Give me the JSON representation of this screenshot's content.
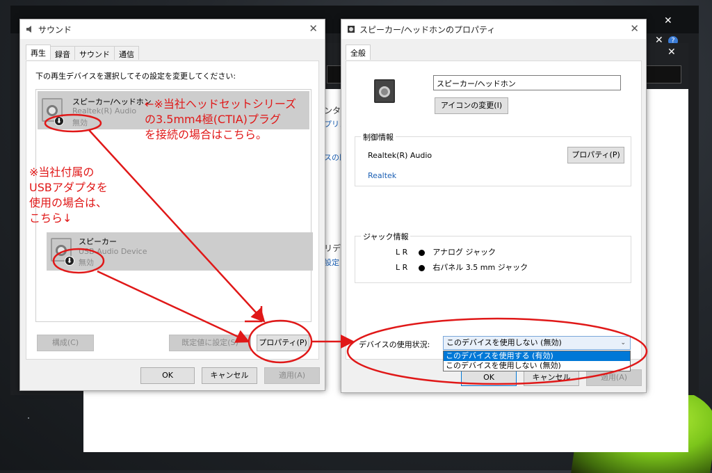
{
  "sound_window": {
    "title": "サウンド",
    "tabs": [
      "再生",
      "録音",
      "サウンド",
      "通信"
    ],
    "active_tab": 0,
    "instruction": "下の再生デバイスを選択してその設定を変更してください:",
    "devices": [
      {
        "name": "スピーカー/ヘッドホン",
        "driver": "Realtek(R) Audio",
        "status": "無効"
      },
      {
        "name": "スピーカー",
        "driver": "USB Audio Device",
        "status": "無効"
      }
    ],
    "buttons": {
      "configure": "構成(C)",
      "set_default": "既定値に設定(S)",
      "properties": "プロパティ(P)"
    },
    "footer": {
      "ok": "OK",
      "cancel": "キャンセル",
      "apply": "適用(A)"
    }
  },
  "props_window": {
    "title": "スピーカー/ヘッドホンのプロパティ",
    "tab": "全般",
    "device_name": "スピーカー/ヘッドホン",
    "change_icon": "アイコンの変更(I)",
    "controller_group": "制御情報",
    "controller_name": "Realtek(R) Audio",
    "controller_props": "プロパティ(P)",
    "vendor_link": "Realtek",
    "jack_group": "ジャック情報",
    "jacks": [
      {
        "channels": "L R",
        "desc": "アナログ ジャック"
      },
      {
        "channels": "L R",
        "desc": "右パネル 3.5 mm ジャック"
      }
    ],
    "usage_label": "デバイスの使用状況:",
    "usage_value": "このデバイスを使用しない (無効)",
    "usage_options": [
      "このデバイスを使用する (有効)",
      "このデバイスを使用しない (無効)"
    ],
    "footer": {
      "ok": "OK",
      "cancel": "キャンセル",
      "apply": "適用(A)"
    }
  },
  "annotations": {
    "note1": [
      "←※当社ヘッドセットシリーズ",
      "の3.5mm4極(CTIA)プラグ",
      "を接続の場合はこちら。"
    ],
    "note2": [
      "※当社付属の",
      "USBアダプタを",
      "使用の場合は、",
      "こちら↓"
    ]
  },
  "background": {
    "fragments": [
      "ンター",
      "プリン",
      "スの既",
      "リデ",
      "設定"
    ]
  },
  "colors": {
    "annotation": "#e01818",
    "accent": "#0078d7",
    "link": "#1a5fb4"
  }
}
